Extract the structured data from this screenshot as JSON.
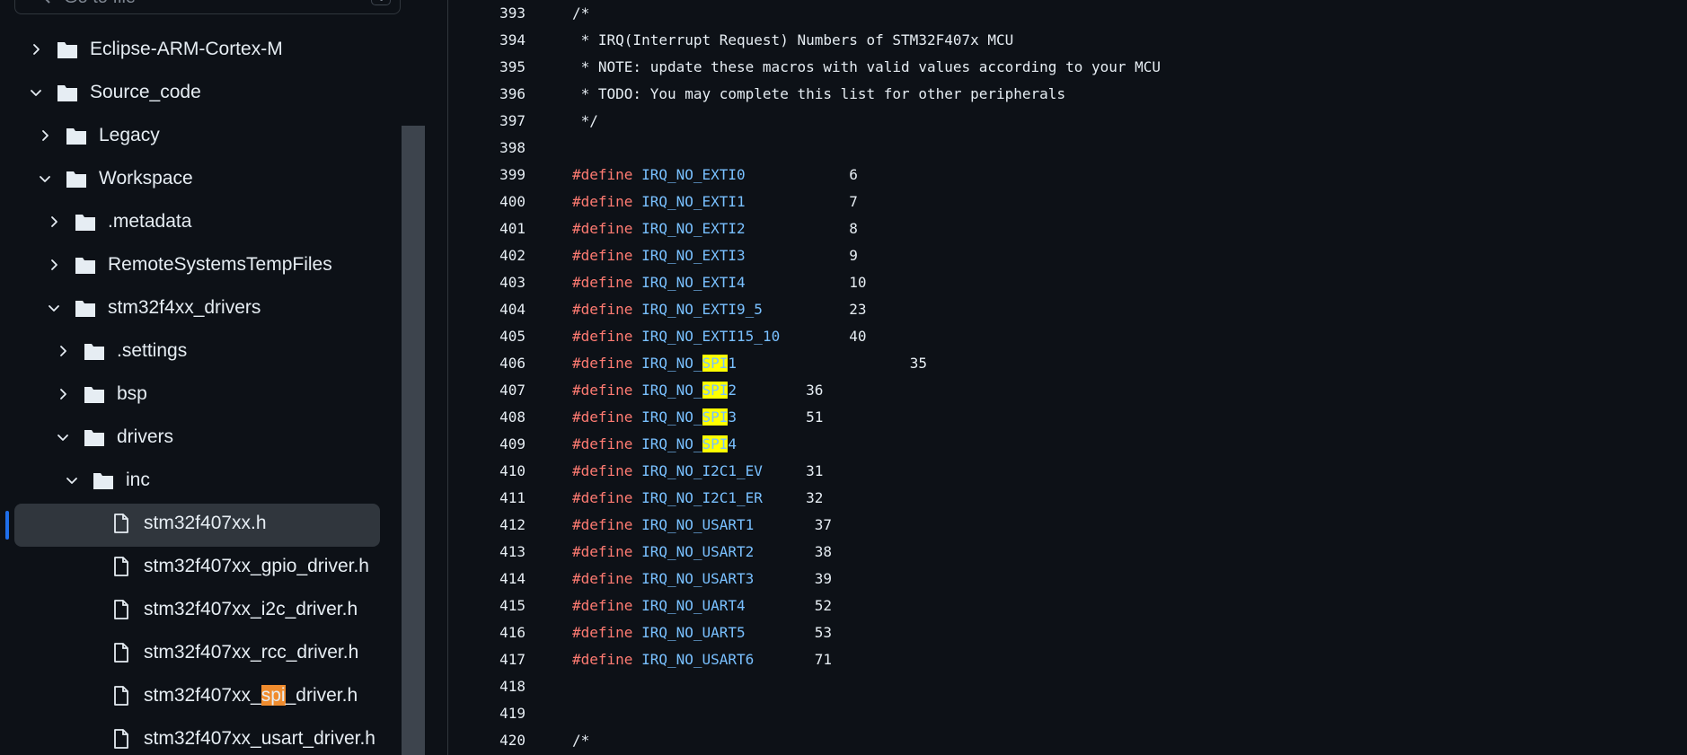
{
  "search": {
    "placeholder": "Go to file",
    "shortcut": "t"
  },
  "tree": [
    {
      "label": "Eclipse-ARM-Cortex-M",
      "type": "folder",
      "expanded": false,
      "depth": 0
    },
    {
      "label": "Source_code",
      "type": "folder",
      "expanded": true,
      "depth": 0
    },
    {
      "label": "Legacy",
      "type": "folder",
      "expanded": false,
      "depth": 1
    },
    {
      "label": "Workspace",
      "type": "folder",
      "expanded": true,
      "depth": 1
    },
    {
      "label": ".metadata",
      "type": "folder",
      "expanded": false,
      "depth": 2
    },
    {
      "label": "RemoteSystemsTempFiles",
      "type": "folder",
      "expanded": false,
      "depth": 2
    },
    {
      "label": "stm32f4xx_drivers",
      "type": "folder",
      "expanded": true,
      "depth": 2
    },
    {
      "label": ".settings",
      "type": "folder",
      "expanded": false,
      "depth": 3
    },
    {
      "label": "bsp",
      "type": "folder",
      "expanded": false,
      "depth": 3
    },
    {
      "label": "drivers",
      "type": "folder",
      "expanded": true,
      "depth": 3
    },
    {
      "label": "inc",
      "type": "folder",
      "expanded": true,
      "depth": 4
    },
    {
      "label": "stm32f407xx.h",
      "type": "file",
      "depth": 5,
      "selected": true
    },
    {
      "label": "stm32f407xx_gpio_driver.h",
      "type": "file",
      "depth": 5
    },
    {
      "label": "stm32f407xx_i2c_driver.h",
      "type": "file",
      "depth": 5
    },
    {
      "label": "stm32f407xx_rcc_driver.h",
      "type": "file",
      "depth": 5
    },
    {
      "label_pre": "stm32f407xx_",
      "label_hl": "spi",
      "label_post": "_driver.h",
      "type": "file",
      "depth": 5
    },
    {
      "label": "stm32f407xx_usart_driver.h",
      "type": "file",
      "depth": 5
    }
  ],
  "code": {
    "highlight_term": "SPI",
    "lines": [
      {
        "n": "393",
        "kind": "comment",
        "text": "/*"
      },
      {
        "n": "394",
        "kind": "comment",
        "text": " * IRQ(Interrupt Request) Numbers of STM32F407x MCU"
      },
      {
        "n": "395",
        "kind": "comment",
        "text": " * NOTE: update these macros with valid values according to your MCU"
      },
      {
        "n": "396",
        "kind": "comment",
        "text": " * TODO: You may complete this list for other peripherals"
      },
      {
        "n": "397",
        "kind": "comment",
        "text": " */"
      },
      {
        "n": "398",
        "kind": "blank",
        "text": ""
      },
      {
        "n": "399",
        "kind": "define",
        "macro": "IRQ_NO_EXTI0",
        "pad": "            ",
        "value": "6"
      },
      {
        "n": "400",
        "kind": "define",
        "macro": "IRQ_NO_EXTI1",
        "pad": "            ",
        "value": "7"
      },
      {
        "n": "401",
        "kind": "define",
        "macro": "IRQ_NO_EXTI2",
        "pad": "            ",
        "value": "8"
      },
      {
        "n": "402",
        "kind": "define",
        "macro": "IRQ_NO_EXTI3",
        "pad": "            ",
        "value": "9"
      },
      {
        "n": "403",
        "kind": "define",
        "macro": "IRQ_NO_EXTI4",
        "pad": "            ",
        "value": "10"
      },
      {
        "n": "404",
        "kind": "define",
        "macro": "IRQ_NO_EXTI9_5",
        "pad": "          ",
        "value": "23"
      },
      {
        "n": "405",
        "kind": "define",
        "macro": "IRQ_NO_EXTI15_10",
        "pad": "        ",
        "value": "40"
      },
      {
        "n": "406",
        "kind": "define",
        "pre": "IRQ_NO_",
        "hl": "SPI",
        "post": "1",
        "pad": "                    ",
        "value": "35"
      },
      {
        "n": "407",
        "kind": "define",
        "pre": "IRQ_NO_",
        "hl": "SPI",
        "post": "2",
        "pad": "        ",
        "value": "36"
      },
      {
        "n": "408",
        "kind": "define",
        "pre": "IRQ_NO_",
        "hl": "SPI",
        "post": "3",
        "pad": "        ",
        "value": "51"
      },
      {
        "n": "409",
        "kind": "define",
        "pre": "IRQ_NO_",
        "hl": "SPI",
        "post": "4",
        "pad": "",
        "value": ""
      },
      {
        "n": "410",
        "kind": "define",
        "macro": "IRQ_NO_I2C1_EV",
        "pad": "     ",
        "value": "31"
      },
      {
        "n": "411",
        "kind": "define",
        "macro": "IRQ_NO_I2C1_ER",
        "pad": "     ",
        "value": "32"
      },
      {
        "n": "412",
        "kind": "define",
        "macro": "IRQ_NO_USART1",
        "pad": "       ",
        "value": "37"
      },
      {
        "n": "413",
        "kind": "define",
        "macro": "IRQ_NO_USART2",
        "pad": "       ",
        "value": "38"
      },
      {
        "n": "414",
        "kind": "define",
        "macro": "IRQ_NO_USART3",
        "pad": "       ",
        "value": "39"
      },
      {
        "n": "415",
        "kind": "define",
        "macro": "IRQ_NO_UART4",
        "pad": "        ",
        "value": "52"
      },
      {
        "n": "416",
        "kind": "define",
        "macro": "IRQ_NO_UART5",
        "pad": "        ",
        "value": "53"
      },
      {
        "n": "417",
        "kind": "define",
        "macro": "IRQ_NO_USART6",
        "pad": "       ",
        "value": "71"
      },
      {
        "n": "418",
        "kind": "blank",
        "text": ""
      },
      {
        "n": "419",
        "kind": "blank",
        "text": ""
      },
      {
        "n": "420",
        "kind": "comment",
        "text": "/*"
      }
    ],
    "define_keyword": "#define"
  },
  "colors": {
    "background": "#0d1117",
    "keyword": "#ff7b72",
    "macro": "#79c0ff",
    "selection": "#30363d",
    "accent_bar": "#1f6feb",
    "search_highlight_code": "#ffff00",
    "search_highlight_tree": "#f08c2e"
  }
}
